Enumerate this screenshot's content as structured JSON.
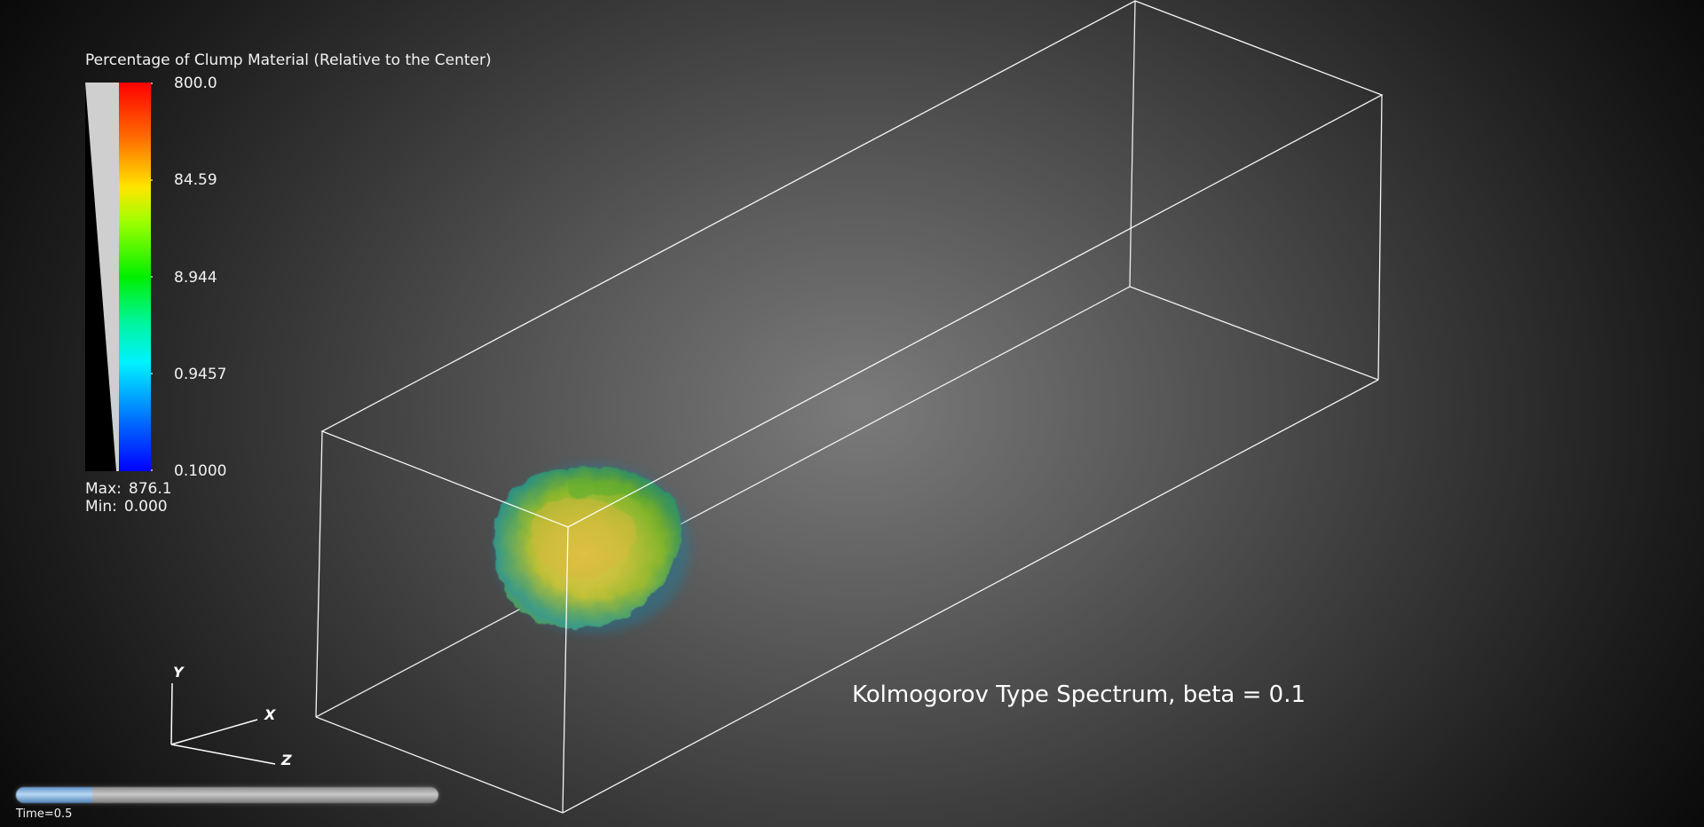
{
  "colorbar": {
    "title": "Percentage of Clump Material (Relative to the Center)",
    "ticks": [
      "800.0",
      "84.59",
      "8.944",
      "0.9457",
      "0.1000"
    ],
    "max_label": "Max:",
    "max_value": "876.1",
    "min_label": "Min:",
    "min_value": "0.000",
    "scale": "logarithmic",
    "colormap": [
      "#ff0000",
      "#ff8800",
      "#ffff00",
      "#00ff00",
      "#00ffff",
      "#0000ff"
    ]
  },
  "axes": {
    "y": "Y",
    "x": "X",
    "z": "Z"
  },
  "annotation": "Kolmogorov Type Spectrum, beta = 0.1",
  "time": {
    "label": "Time=0.5",
    "progress": 0.18
  },
  "colors": {
    "background_center": "#7b7b7b",
    "background_edge": "#080808",
    "box_outline": "#ffffff",
    "clump_primary": "#9fc22a",
    "clump_secondary": "#1f7fa0"
  }
}
